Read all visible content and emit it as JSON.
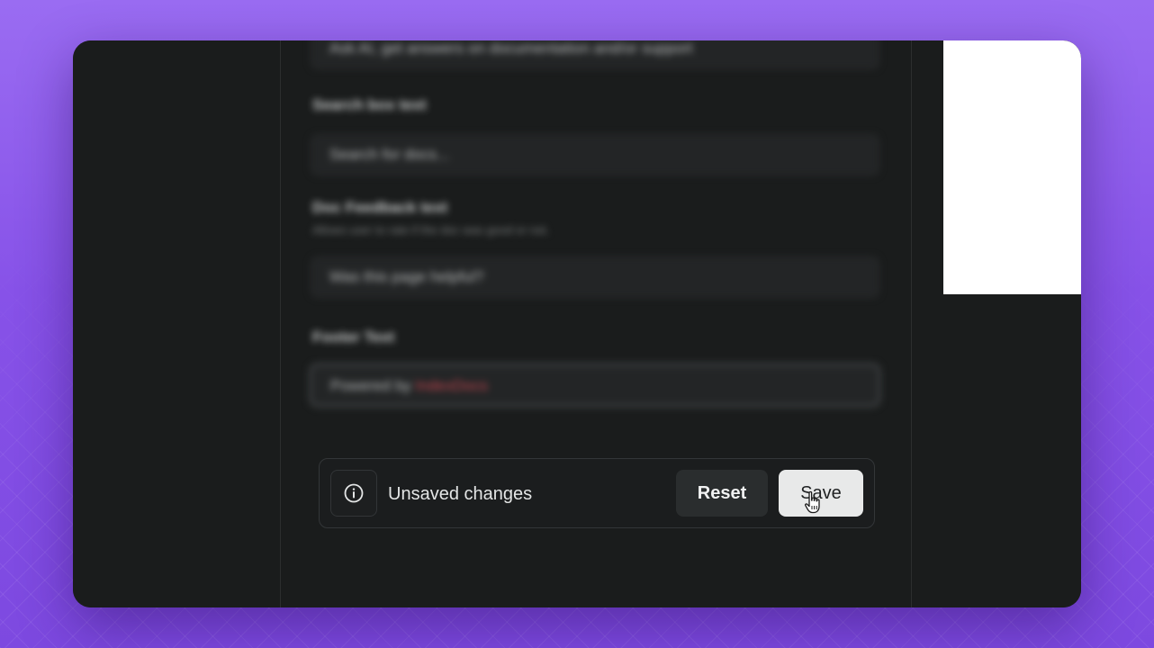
{
  "form": {
    "top_field_value": "Ask AI, get answers on documentation and/or support",
    "search_label": "Search box text",
    "search_value": "Search for docs...",
    "feedback_label": "Doc Feedback text",
    "feedback_help": "Allows user to rate if the doc was good or not.",
    "feedback_value": "Was this page helpful?",
    "footer_label": "Footer Text",
    "footer_value_prefix": "Powered by ",
    "footer_value_brand": "IndexDocs"
  },
  "savebar": {
    "status": "Unsaved changes",
    "reset_label": "Reset",
    "save_label": "Save"
  },
  "icons": {
    "status": "info-circle-icon",
    "pointer": "hand-pointer-cursor"
  },
  "colors": {
    "background_top": "#9a6cf2",
    "window": "#1a1c1c",
    "save_button": "#e8e9e9",
    "reset_button": "#2a2d2e",
    "brand_link": "#c2454f"
  }
}
